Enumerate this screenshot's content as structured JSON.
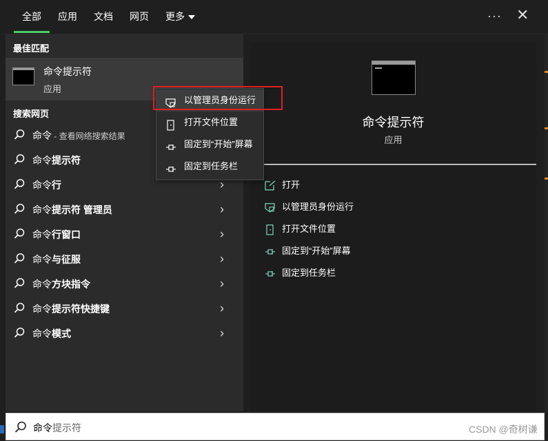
{
  "tabs": [
    {
      "label": "全部",
      "active": true
    },
    {
      "label": "应用"
    },
    {
      "label": "文档"
    },
    {
      "label": "网页"
    },
    {
      "label": "更多"
    }
  ],
  "header": {
    "more_icon": "ellipsis-icon",
    "close_icon": "close-icon"
  },
  "best_match": {
    "section_title": "最佳匹配",
    "name": "命令提示符",
    "type": "应用"
  },
  "web_search": {
    "section_title": "搜索网页",
    "items": [
      {
        "prefix": "命令",
        "bold": "",
        "sub": " - 查看网络搜索结果",
        "chevron": false
      },
      {
        "prefix": "命令",
        "bold": "提示符",
        "sub": "",
        "chevron": false
      },
      {
        "prefix": "命令",
        "bold": "行",
        "sub": "",
        "chevron": true
      },
      {
        "prefix": "命令",
        "bold": "提示符 管理员",
        "sub": "",
        "chevron": true
      },
      {
        "prefix": "命令",
        "bold": "行窗口",
        "sub": "",
        "chevron": true
      },
      {
        "prefix": "命令",
        "bold": "与征服",
        "sub": "",
        "chevron": true
      },
      {
        "prefix": "命令",
        "bold": "方块指令",
        "sub": "",
        "chevron": true
      },
      {
        "prefix": "命令",
        "bold": "提示符快捷键",
        "sub": "",
        "chevron": true
      },
      {
        "prefix": "命令",
        "bold": "模式",
        "sub": "",
        "chevron": true
      }
    ]
  },
  "context_menu": {
    "items": [
      {
        "label": "以管理员身份运行",
        "icon": "shield-icon",
        "highlighted": true
      },
      {
        "label": "打开文件位置",
        "icon": "folder-icon"
      },
      {
        "label": "固定到“开始”屏幕",
        "icon": "pin-icon"
      },
      {
        "label": "固定到任务栏",
        "icon": "pin-icon"
      }
    ]
  },
  "detail": {
    "title": "命令提示符",
    "type": "应用",
    "actions": [
      {
        "label": "打开",
        "icon": "open-icon"
      },
      {
        "label": "以管理员身份运行",
        "icon": "shield-icon"
      },
      {
        "label": "打开文件位置",
        "icon": "folder-icon"
      },
      {
        "label": "固定到“开始”屏幕",
        "icon": "pin-icon"
      },
      {
        "label": "固定到任务栏",
        "icon": "pin-icon"
      }
    ]
  },
  "search": {
    "typed": "命令",
    "suggestion": "提示符"
  },
  "watermark": "CSDN @奇树谦",
  "colors": {
    "accent": "#45d06a",
    "highlight_box": "#e02020",
    "icon_teal": "#7fd8c0"
  }
}
